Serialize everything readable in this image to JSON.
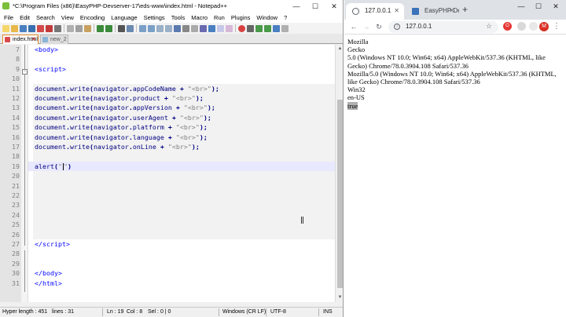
{
  "npp": {
    "title": "*C:\\Program Files (x86)\\EasyPHP-Devserver-17\\eds-www\\index.html - Notepad++",
    "window_controls": {
      "minimize": "—",
      "maximize": "☐",
      "close": "✕"
    },
    "menu": [
      "File",
      "Edit",
      "Search",
      "View",
      "Encoding",
      "Language",
      "Settings",
      "Tools",
      "Macro",
      "Run",
      "Plugins",
      "Window",
      "?"
    ],
    "tabs": [
      {
        "label": "index.html",
        "close": "✕"
      },
      {
        "label": "new_2"
      }
    ],
    "lines": [
      {
        "n": "7",
        "html": "<span class=\"tag\">&lt;body&gt;</span>"
      },
      {
        "n": "8",
        "html": ""
      },
      {
        "n": "9",
        "html": "<span class=\"tag\">&lt;script&gt;</span>"
      },
      {
        "n": "10",
        "html": ""
      },
      {
        "n": "11",
        "html": "<span class=\"obj\">document</span><span class=\"punc\">.</span><span class=\"obj\">write</span><span class=\"punc\">(</span><span class=\"obj\">navigator</span><span class=\"punc\">.</span><span class=\"obj\">appCodeName</span> <span class=\"punc\">+</span> <span class=\"str\">\"&lt;br&gt;\"</span><span class=\"punc\">);</span>"
      },
      {
        "n": "12",
        "html": "<span class=\"obj\">document</span><span class=\"punc\">.</span><span class=\"obj\">write</span><span class=\"punc\">(</span><span class=\"obj\">navigator</span><span class=\"punc\">.</span><span class=\"obj\">product</span> <span class=\"punc\">+</span> <span class=\"str\">\"&lt;br&gt;\"</span><span class=\"punc\">);</span>"
      },
      {
        "n": "13",
        "html": "<span class=\"obj\">document</span><span class=\"punc\">.</span><span class=\"obj\">write</span><span class=\"punc\">(</span><span class=\"obj\">navigator</span><span class=\"punc\">.</span><span class=\"obj\">appVersion</span> <span class=\"punc\">+</span> <span class=\"str\">\"&lt;br&gt;\"</span><span class=\"punc\">);</span>"
      },
      {
        "n": "14",
        "html": "<span class=\"obj\">document</span><span class=\"punc\">.</span><span class=\"obj\">write</span><span class=\"punc\">(</span><span class=\"obj\">navigator</span><span class=\"punc\">.</span><span class=\"obj\">userAgent</span> <span class=\"punc\">+</span> <span class=\"str\">\"&lt;br&gt;\"</span><span class=\"punc\">);</span>"
      },
      {
        "n": "15",
        "html": "<span class=\"obj\">document</span><span class=\"punc\">.</span><span class=\"obj\">write</span><span class=\"punc\">(</span><span class=\"obj\">navigator</span><span class=\"punc\">.</span><span class=\"obj\">platform</span> <span class=\"punc\">+</span> <span class=\"str\">\"&lt;br&gt;\"</span><span class=\"punc\">);</span>"
      },
      {
        "n": "16",
        "html": "<span class=\"obj\">document</span><span class=\"punc\">.</span><span class=\"obj\">write</span><span class=\"punc\">(</span><span class=\"obj\">navigator</span><span class=\"punc\">.</span><span class=\"obj\">language</span> <span class=\"punc\">+</span> <span class=\"str\">\"&lt;br&gt;\"</span><span class=\"punc\">);</span>"
      },
      {
        "n": "17",
        "html": "<span class=\"obj\">document</span><span class=\"punc\">.</span><span class=\"obj\">write</span><span class=\"punc\">(</span><span class=\"obj\">navigator</span><span class=\"punc\">.</span><span class=\"obj\">onLine</span> <span class=\"punc\">+</span> <span class=\"str\">\"&lt;br&gt;\"</span><span class=\"punc\">);</span>"
      },
      {
        "n": "18",
        "html": ""
      },
      {
        "n": "19",
        "html": "<span class=\"obj\">alert</span><span class=\"punc\">(</span><span class=\"str\">\"<span class=\"caret\"></span>\"</span><span class=\"punc\">)</span>"
      },
      {
        "n": "20",
        "html": ""
      },
      {
        "n": "21",
        "html": ""
      },
      {
        "n": "22",
        "html": ""
      },
      {
        "n": "23",
        "html": ""
      },
      {
        "n": "24",
        "html": ""
      },
      {
        "n": "25",
        "html": ""
      },
      {
        "n": "26",
        "html": ""
      },
      {
        "n": "27",
        "html": "<span class=\"tag\">&lt;/script&gt;</span>"
      },
      {
        "n": "28",
        "html": ""
      },
      {
        "n": "29",
        "html": ""
      },
      {
        "n": "30",
        "html": "<span class=\"tag\">&lt;/body&gt;</span>"
      },
      {
        "n": "31",
        "html": "<span class=\"tag\">&lt;/html&gt;</span>"
      }
    ],
    "status": {
      "length": "Hyper length : 451",
      "lines": "lines : 31",
      "pos": "Ln : 19",
      "col": "Col : 8",
      "sel": "Sel : 0 | 0",
      "eol": "Windows (CR LF)",
      "encoding": "UTF-8",
      "mode": "INS"
    }
  },
  "chrome": {
    "tabs": [
      {
        "label": "127.0.0.1",
        "close": "✕"
      },
      {
        "label": "EasyPHP Dev",
        "close": "✕"
      }
    ],
    "newtab": "+",
    "window_controls": {
      "minimize": "—",
      "maximize": "☐",
      "close": "✕"
    },
    "url": "127.0.0.1",
    "ext_label": "O",
    "avatar": "M",
    "output": [
      "Mozilla",
      "Gecko",
      "5.0 (Windows NT 10.0; Win64; x64) AppleWebKit/537.36 (KHTML, like Gecko) Chrome/78.0.3904.108 Safari/537.36",
      "Mozilla/5.0 (Windows NT 10.0; Win64; x64) AppleWebKit/537.36 (KHTML, like Gecko) Chrome/78.0.3904.108 Safari/537.36",
      "Win32",
      "en-US",
      "true"
    ]
  },
  "colors": {
    "npp_tab_accent": "#e08a2a",
    "current_line": "#e8e8ff",
    "tag": "#0000ff",
    "string": "#808080",
    "chrome_tabbar": "#dee1e6"
  }
}
